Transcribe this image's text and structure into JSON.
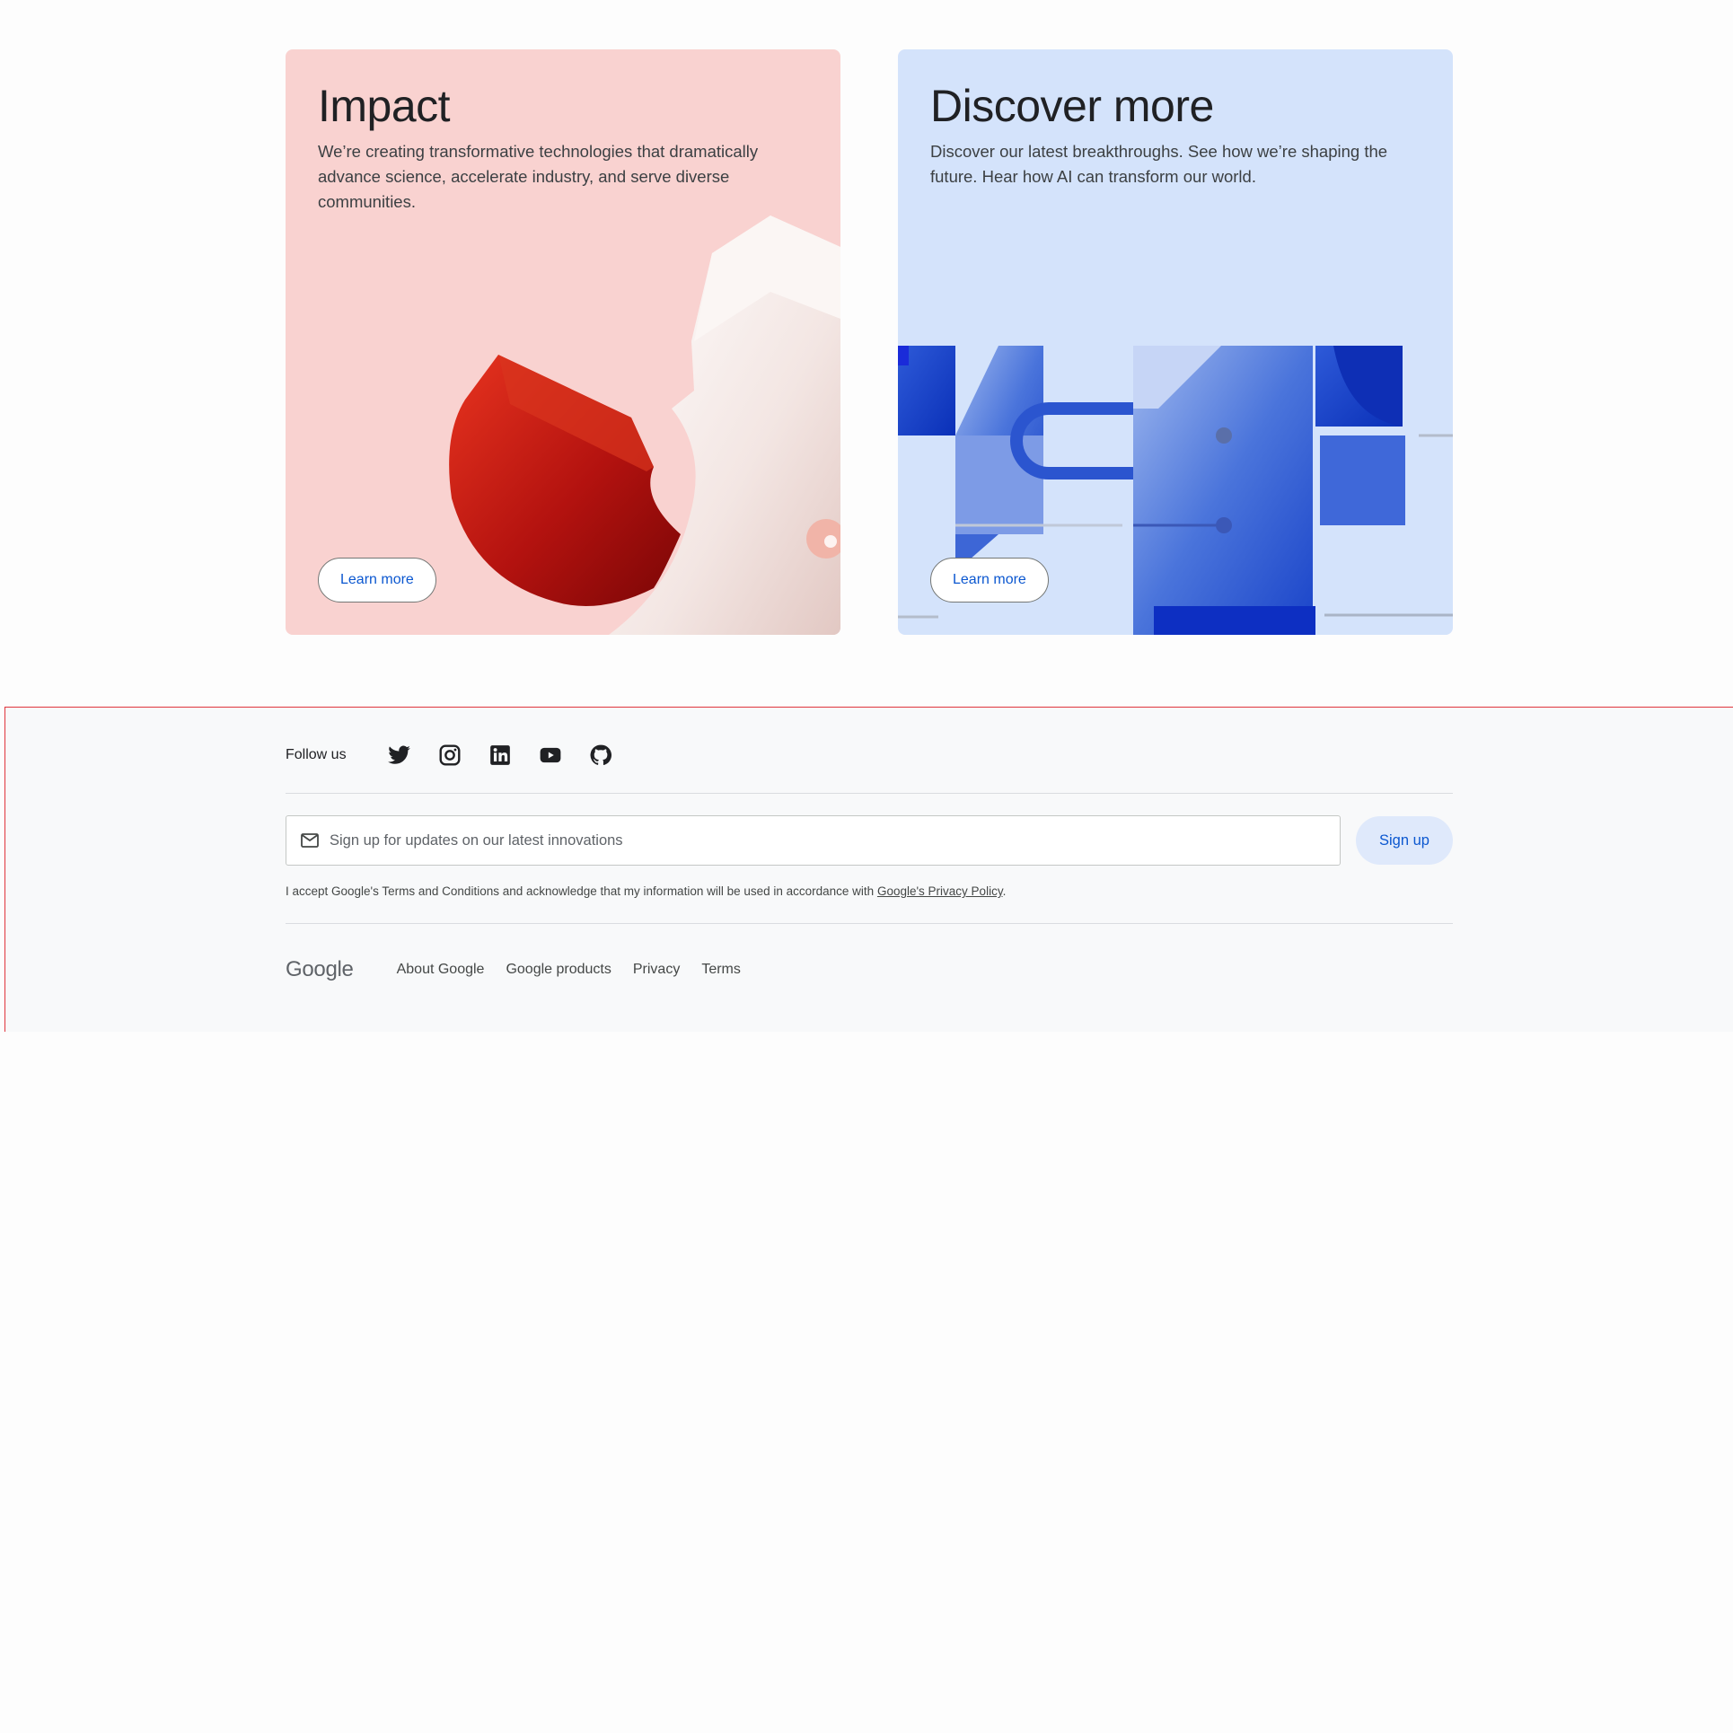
{
  "cards": [
    {
      "title": "Impact",
      "description": "We’re creating transformative technologies that dramatically advance science, accelerate industry, and serve diverse communities.",
      "button_label": "Learn more",
      "background": "#f9d2d0"
    },
    {
      "title": "Discover more",
      "description": "Discover our latest breakthroughs. See how we’re shaping the future. Hear how AI can transform our world.",
      "button_label": "Learn more",
      "background": "#d4e3fb"
    }
  ],
  "footer": {
    "follow_label": "Follow us",
    "social_icons": [
      "twitter-icon",
      "instagram-icon",
      "linkedin-icon",
      "youtube-icon",
      "github-icon"
    ],
    "signup": {
      "placeholder": "Sign up for updates on our latest innovations",
      "button_label": "Sign up"
    },
    "consent": {
      "text": "I accept Google's Terms and Conditions and acknowledge that my information will be used in accordance with ",
      "link_label": "Google's Privacy Policy",
      "suffix": "."
    },
    "logo_text": "Google",
    "links": [
      "About Google",
      "Google products",
      "Privacy",
      "Terms"
    ]
  },
  "colors": {
    "accent": "#0b57d0",
    "footer_bg": "#f8f9fa",
    "footer_border": "#e0353d"
  }
}
